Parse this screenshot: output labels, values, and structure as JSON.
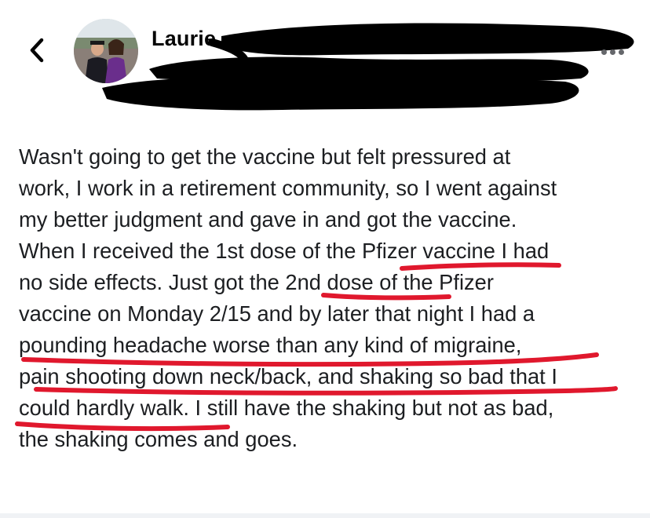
{
  "header": {
    "author_name": "Laurie",
    "back_icon": "chevron-left-icon",
    "more_icon": "more-horizontal-icon"
  },
  "post": {
    "lines": [
      "Wasn't going to get the vaccine but felt pressured at",
      "work, I work in a retirement community, so I went against",
      "my better judgment and gave in and got the vaccine.",
      "When I received the 1st dose of the Pfizer vaccine I had",
      "no side effects. Just got the 2nd dose of the Pfizer",
      "vaccine on Monday 2/15 and by later that night I had a",
      "pounding headache worse than any kind of migraine,",
      "pain shooting down neck/back, and shaking so bad that I",
      "could hardly walk. I still have the shaking but not as bad,",
      "the shaking comes and goes."
    ]
  },
  "colors": {
    "redaction": "#000000",
    "annotation_underline": "#e0182d",
    "text": "#1c1e21",
    "more_dots": "#65676b"
  }
}
